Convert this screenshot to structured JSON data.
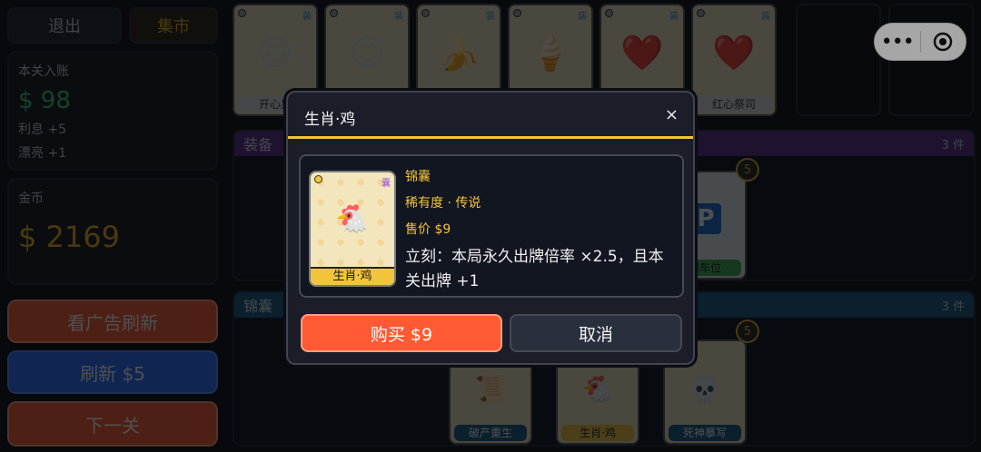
{
  "left": {
    "exit_label": "退出",
    "market_label": "集市",
    "income": {
      "label": "本关入账",
      "value": "$ 98",
      "interest": "利息 +5",
      "pretty": "漂亮 +1"
    },
    "coins": {
      "label": "金币",
      "value": "$ 2169"
    },
    "ad_refresh_label": "看广告刷新",
    "refresh_label": "刷新 $5",
    "next_label": "下一关"
  },
  "top_cards": [
    {
      "name": "开心果",
      "icon": "grin-icon",
      "glyph": "😄",
      "corner": "装"
    },
    {
      "name": "",
      "icon": "smile-icon",
      "glyph": "😊",
      "corner": "装"
    },
    {
      "name": "",
      "icon": "banana-icon",
      "glyph": "🍌",
      "corner": "装"
    },
    {
      "name": "",
      "icon": "ice-cream-icon",
      "glyph": "🍦",
      "corner": "装"
    },
    {
      "name": "",
      "icon": "heart-icon",
      "glyph": "❤️",
      "corner": "装"
    },
    {
      "name": "红心祭司",
      "icon": "heart-icon",
      "glyph": "❤️",
      "corner": "装"
    }
  ],
  "equip_section": {
    "title": "装备",
    "count": "3 件",
    "visible_card_name": "用车位",
    "visible_card_glyph": "P",
    "level": "5"
  },
  "pouch_section": {
    "title": "锦囊",
    "count": "3 件",
    "cards": [
      {
        "name": "破产重生",
        "glyph": "📜",
        "label_color": "#1a5a82"
      },
      {
        "name": "生肖·鸡",
        "glyph": "🐔",
        "label_color": "#f2c43c"
      },
      {
        "name": "死神摹写",
        "glyph": "💀",
        "label_color": "#1a5a82"
      }
    ],
    "level": "5"
  },
  "capsule": {
    "more": "•••"
  },
  "modal": {
    "title": "生肖·鸡",
    "close": "×",
    "card": {
      "name": "生肖·鸡",
      "corner": "囊",
      "glyph": "🐔"
    },
    "type": "锦囊",
    "rarity": "稀有度 · 传说",
    "price": "售价 $9",
    "effect": "立刻：本局永久出牌倍率 ×2.5，且本关出牌 +1",
    "buy_label": "购买 $9",
    "cancel_label": "取消"
  },
  "colors": {
    "accent_gold": "#f2c43c",
    "buy_orange": "#ff5a33",
    "refresh_blue": "#2b6fff",
    "income_green": "#3dd47a",
    "equip_purple": "#5a2f8a",
    "pouch_blue": "#1a5a82"
  }
}
